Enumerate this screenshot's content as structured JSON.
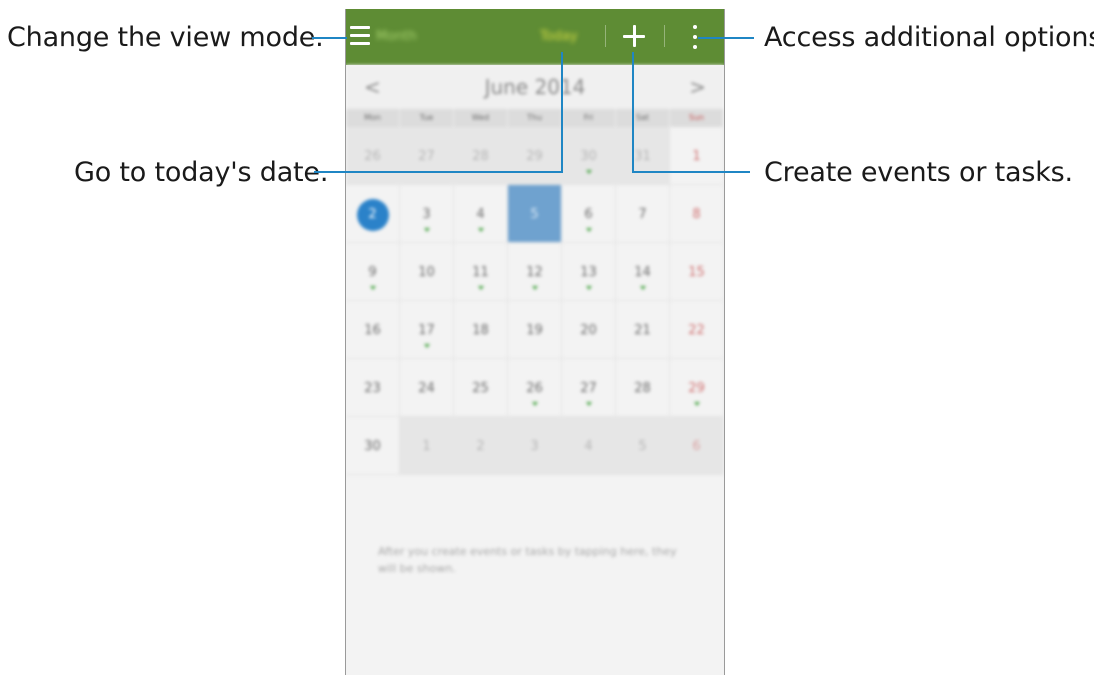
{
  "callouts": {
    "view_mode": "Change the view mode.",
    "today": "Go to today's date.",
    "more_options": "Access additional options.",
    "create": "Create events or tasks."
  },
  "actionbar": {
    "title": "Month",
    "today_label": "Today",
    "menu_icon": "hamburger-menu-icon",
    "add_icon": "plus-icon",
    "more_icon": "vertical-ellipsis-icon",
    "background_color": "#5e8c34"
  },
  "calendar": {
    "month_title": "June 2014",
    "prev_arrow": "<",
    "next_arrow": ">",
    "weekdays": [
      "Mon",
      "Tue",
      "Wed",
      "Thu",
      "Fri",
      "Sat",
      "Sun"
    ],
    "weeks": [
      [
        {
          "n": "26",
          "other": true
        },
        {
          "n": "27",
          "other": true
        },
        {
          "n": "28",
          "other": true
        },
        {
          "n": "29",
          "other": true
        },
        {
          "n": "30",
          "other": true,
          "event": true
        },
        {
          "n": "31",
          "other": true
        },
        {
          "n": "1",
          "sun": true
        }
      ],
      [
        {
          "n": "2",
          "today": true
        },
        {
          "n": "3",
          "event": true
        },
        {
          "n": "4",
          "event": true
        },
        {
          "n": "5",
          "selected": true
        },
        {
          "n": "6",
          "event": true
        },
        {
          "n": "7"
        },
        {
          "n": "8",
          "sun": true
        }
      ],
      [
        {
          "n": "9",
          "event": true
        },
        {
          "n": "10"
        },
        {
          "n": "11",
          "event": true
        },
        {
          "n": "12",
          "event": true
        },
        {
          "n": "13",
          "event": true
        },
        {
          "n": "14",
          "event": true
        },
        {
          "n": "15",
          "sun": true
        }
      ],
      [
        {
          "n": "16"
        },
        {
          "n": "17",
          "event": true
        },
        {
          "n": "18"
        },
        {
          "n": "19"
        },
        {
          "n": "20"
        },
        {
          "n": "21"
        },
        {
          "n": "22",
          "sun": true
        }
      ],
      [
        {
          "n": "23"
        },
        {
          "n": "24"
        },
        {
          "n": "25"
        },
        {
          "n": "26",
          "event": true
        },
        {
          "n": "27",
          "event": true
        },
        {
          "n": "28"
        },
        {
          "n": "29",
          "sun": true,
          "event": true
        }
      ],
      [
        {
          "n": "30"
        },
        {
          "n": "1",
          "other": true
        },
        {
          "n": "2",
          "other": true
        },
        {
          "n": "3",
          "other": true
        },
        {
          "n": "4",
          "other": true
        },
        {
          "n": "5",
          "other": true
        },
        {
          "n": "6",
          "other": true,
          "sun": true
        }
      ]
    ],
    "empty_hint": "After you create events or tasks by tapping here, they will be shown."
  },
  "colors": {
    "callout_line": "#1f86c4",
    "today_circle": "#2b82c9",
    "selected_day": "#6fa2cf",
    "event_marker": "#4aa546"
  }
}
